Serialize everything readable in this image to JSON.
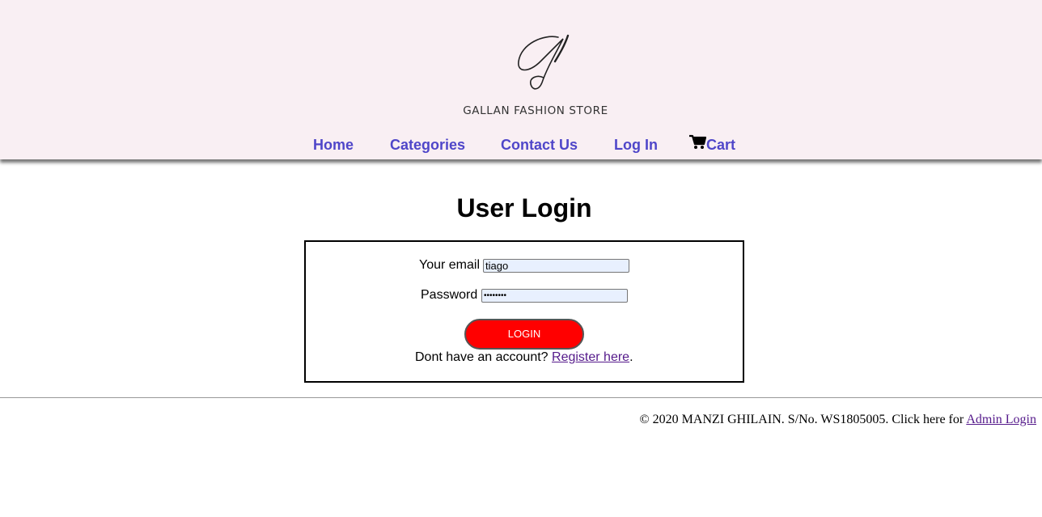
{
  "header": {
    "brand_name": "GALLAN FASHION STORE",
    "logo_letter": "G",
    "background_color": "#f9eff3"
  },
  "nav": {
    "items": [
      {
        "label": "Home"
      },
      {
        "label": "Categories"
      },
      {
        "label": "Contact Us"
      },
      {
        "label": "Log In"
      },
      {
        "label": "Cart",
        "icon": "cart-icon"
      }
    ],
    "link_color": "#4f46c9"
  },
  "main": {
    "title": "User Login",
    "form": {
      "email_label": "Your email",
      "email_value": "tiago",
      "password_label": "Password",
      "password_value": "••••••••",
      "login_button": "LOGIN",
      "register_prompt": "Dont have an account?",
      "register_link": "Register here",
      "register_suffix": ".",
      "button_color": "#ff0000"
    }
  },
  "footer": {
    "text": "© 2020 MANZI GHILAIN. S/No. WS1805005. Click here for",
    "admin_link": "Admin Login"
  }
}
